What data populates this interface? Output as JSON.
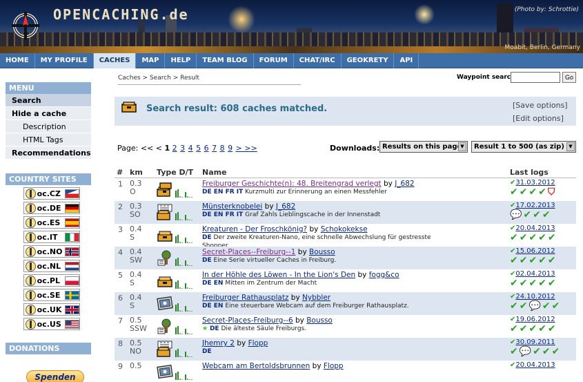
{
  "site": {
    "title": "OPENCACHING.de",
    "photo_credit": "(Photo by: Schrottie)",
    "photo_location": "Moabit, Berlin, Germany"
  },
  "nav": [
    "HOME",
    "MY PROFILE",
    "CACHES",
    "MAP",
    "HELP",
    "TEAM BLOG",
    "FORUM",
    "CHAT/IRC",
    "GEOKRETY",
    "API"
  ],
  "nav_active": "CACHES",
  "breadcrumb": "Caches > Search > Result",
  "waypoint": {
    "label": "Waypoint search",
    "value": "",
    "go": "Go"
  },
  "sidebar": {
    "menu_title": "MENU",
    "items": [
      {
        "label": "Search",
        "bold": true,
        "sub": false,
        "active": true
      },
      {
        "label": "Hide a cache",
        "bold": true,
        "sub": false
      },
      {
        "label": "Description",
        "bold": false,
        "sub": true
      },
      {
        "label": "HTML Tags",
        "bold": false,
        "sub": true
      },
      {
        "label": "Recommendations",
        "bold": true,
        "sub": false
      }
    ],
    "country_title": "COUNTRY SITES",
    "countries": [
      {
        "label": "oc.CZ",
        "flag": "cz"
      },
      {
        "label": "oc.DE",
        "flag": "de"
      },
      {
        "label": "oc.ES",
        "flag": "es"
      },
      {
        "label": "oc.IT",
        "flag": "it"
      },
      {
        "label": "oc.NO",
        "flag": "no"
      },
      {
        "label": "oc.NL",
        "flag": "nl"
      },
      {
        "label": "oc.PL",
        "flag": "pl"
      },
      {
        "label": "oc.SE",
        "flag": "se"
      },
      {
        "label": "oc.UK",
        "flag": "uk"
      },
      {
        "label": "oc.US",
        "flag": "us"
      }
    ],
    "donations_title": "DONATIONS",
    "donate_button": "Spenden"
  },
  "result": {
    "title": "Search result: 608 caches matched.",
    "save_options": "[Save options]",
    "edit_options": "[Edit options]"
  },
  "pager": {
    "label": "Page:",
    "prev": "<< <",
    "current": "1",
    "pages": [
      "2",
      "3",
      "4",
      "5",
      "6",
      "7",
      "8",
      "9"
    ],
    "next": "> >>"
  },
  "downloads": {
    "label": "Downloads:",
    "select1": "Results on this page",
    "select2": "Result 1 to 500 (as zip)"
  },
  "table": {
    "headers": {
      "num": "#",
      "km": "km",
      "type": "Type D/T",
      "name": "Name",
      "logs": "Last logs"
    },
    "rows": [
      {
        "n": "1",
        "km": "0.3",
        "dir": "O",
        "name": "Freiburger Geschichte(n): 48. Breitengrad verlegt",
        "visited": true,
        "by": "J_682",
        "langs": "DE EN FR IT",
        "desc": "Kurzmulti zur Erinnerung an einen Messfehler",
        "date": "31.03.2012",
        "ticks": "✔✔✔✔",
        "extra": "⛉",
        "alt": false,
        "icon": "multi"
      },
      {
        "n": "2",
        "km": "0.3",
        "dir": "SO",
        "name": "Münsterknobelei",
        "visited": false,
        "by": "J_682",
        "langs": "DE EN FR IT",
        "desc": "Graf Zahls Lieblingscache in der Innenstadt",
        "date": "17.02.2013",
        "ticks": "💬✔✔✔",
        "extra": "",
        "alt": true,
        "icon": "mystery"
      },
      {
        "n": "3",
        "km": "0.4",
        "dir": "S",
        "name": "Kreaturen - Der Froschkönig?",
        "visited": false,
        "by": "Schokokekse",
        "langs": "DE",
        "desc": "Der zweite Kreaturen-Nano, eine schnelle Abwechslung für gestresste Shopper.",
        "date": "20.04.2013",
        "ticks": "✔✔✔✔✔",
        "extra": "",
        "alt": false,
        "icon": "traditional"
      },
      {
        "n": "4",
        "km": "0.4",
        "dir": "SW",
        "name": "Secret-Places--Freiburg--1",
        "visited": true,
        "by": "Bousso",
        "langs": "DE",
        "desc": "Eine Serie virtueller Caches in Freiburg.",
        "date": "15.06.2012",
        "ticks": "✔✔✔✔✔",
        "extra": "",
        "alt": true,
        "icon": "virtual"
      },
      {
        "n": "5",
        "km": "0.4",
        "dir": "S",
        "name": "In der Höhle des Löwen - In the Lion's Den",
        "visited": false,
        "by": "fogg&co",
        "langs": "DE EN",
        "desc": "Mitten im Zentrum der Macht",
        "date": "02.04.2013",
        "ticks": "✔✔✔✔✔",
        "extra": "",
        "alt": false,
        "icon": "traditional"
      },
      {
        "n": "6",
        "km": "0.4",
        "dir": "S",
        "name": "Freiburger Rathausplatz",
        "visited": false,
        "by": "Nybbler",
        "langs": "DE EN",
        "desc": "Eine steuerbare Webcam auf dem Freiburger Rathausplatz.",
        "date": "24.10.2012",
        "ticks": "✔✔💬✔✔",
        "extra": "",
        "alt": true,
        "icon": "webcam"
      },
      {
        "n": "7",
        "km": "0.5",
        "dir": "SSW",
        "name": "Secret-Places-Freiburg--6",
        "visited": false,
        "by": "Bousso",
        "langs": "DE",
        "desc": "Die älteste Säule Freiburgs.",
        "date": "19.06.2012",
        "ticks": "✔✔✔✔✔",
        "extra": "",
        "alt": false,
        "icon": "virtual",
        "star": true
      },
      {
        "n": "8",
        "km": "0.5",
        "dir": "NO",
        "name": "Jhemry 2",
        "visited": false,
        "by": "Flopp",
        "langs": "DE",
        "desc": "",
        "date": "30.09.2011",
        "ticks": "✔💬✔✔✔",
        "extra": "",
        "alt": true,
        "icon": "mystery"
      },
      {
        "n": "9",
        "km": "0.5",
        "dir": "",
        "name": "Webcam am Bertoldsbrunnen",
        "visited": false,
        "by": "Flopp",
        "langs": "",
        "desc": "",
        "date": "20.04.2013",
        "ticks": "",
        "extra": "",
        "alt": false,
        "icon": "webcam"
      }
    ]
  }
}
